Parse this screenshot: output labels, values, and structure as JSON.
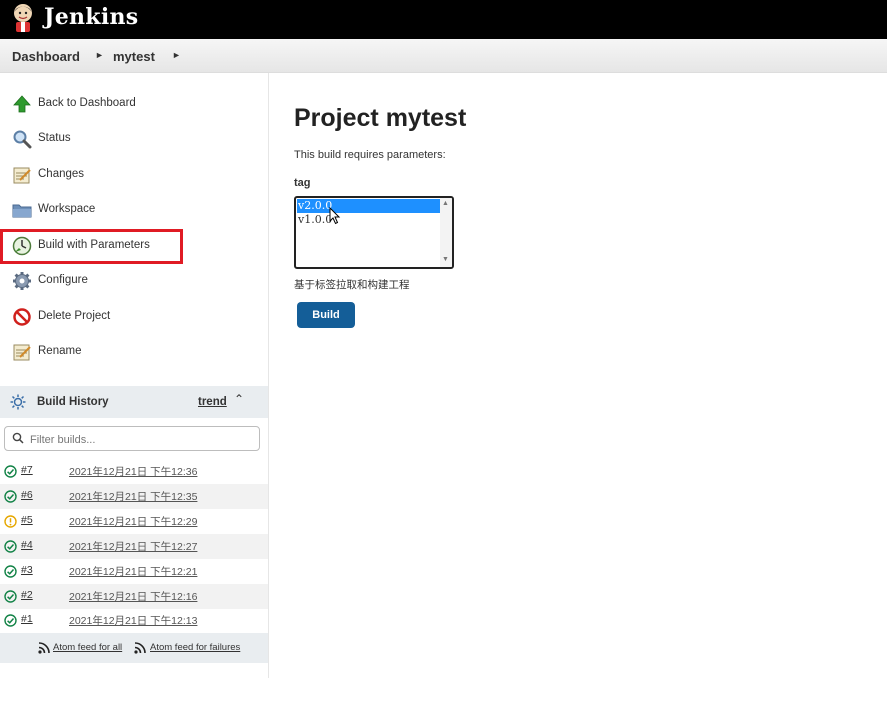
{
  "app": {
    "brand": "Jenkins"
  },
  "breadcrumb": [
    {
      "label": "Dashboard"
    },
    {
      "label": "mytest"
    }
  ],
  "sidebar": {
    "items": [
      {
        "label": "Back to Dashboard",
        "icon": "up-arrow-icon"
      },
      {
        "label": "Status",
        "icon": "search-icon"
      },
      {
        "label": "Changes",
        "icon": "notepad-icon"
      },
      {
        "label": "Workspace",
        "icon": "folder-icon"
      },
      {
        "label": "Build with Parameters",
        "icon": "clock-build-icon",
        "highlighted": true
      },
      {
        "label": "Configure",
        "icon": "gear-icon"
      },
      {
        "label": "Delete Project",
        "icon": "no-entry-icon"
      },
      {
        "label": "Rename",
        "icon": "notepad-icon"
      }
    ]
  },
  "build_history": {
    "title": "Build History",
    "trend_label": "trend",
    "filter_placeholder": "Filter builds...",
    "builds": [
      {
        "number": "#7",
        "date": "2021年12月21日 下午12:36",
        "status": "success"
      },
      {
        "number": "#6",
        "date": "2021年12月21日 下午12:35",
        "status": "success"
      },
      {
        "number": "#5",
        "date": "2021年12月21日 下午12:29",
        "status": "unstable"
      },
      {
        "number": "#4",
        "date": "2021年12月21日 下午12:27",
        "status": "success"
      },
      {
        "number": "#3",
        "date": "2021年12月21日 下午12:21",
        "status": "success"
      },
      {
        "number": "#2",
        "date": "2021年12月21日 下午12:16",
        "status": "success"
      },
      {
        "number": "#1",
        "date": "2021年12月21日 下午12:13",
        "status": "success"
      }
    ],
    "feeds": {
      "all": "Atom feed for all",
      "failures": "Atom feed for failures"
    }
  },
  "main": {
    "title": "Project mytest",
    "subtitle": "This build requires parameters:",
    "parameter": {
      "name": "tag",
      "options": [
        "v2.0.0",
        "v1.0.0"
      ],
      "selected": "v2.0.0",
      "description": "基于标签拉取和构建工程"
    },
    "build_button": "Build"
  },
  "colors": {
    "highlight": "#e01b24",
    "build_button": "#145e98",
    "selected_option": "#1e90ff",
    "success": "#138347",
    "unstable": "#e6a700"
  }
}
